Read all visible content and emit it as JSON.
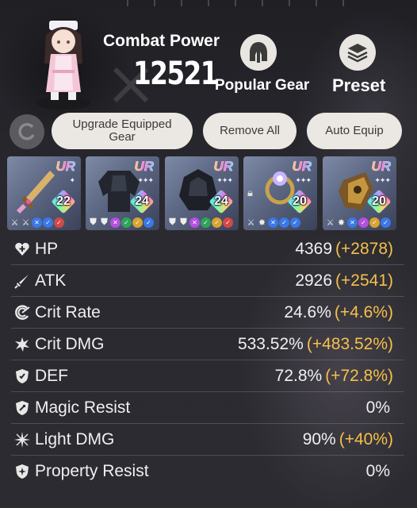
{
  "header": {
    "combat_power_label": "Combat Power",
    "combat_power_value": "12521",
    "popular_gear_label": "Popular Gear",
    "preset_label": "Preset"
  },
  "actions": {
    "upgrade_label": "Upgrade Equipped Gear",
    "remove_all_label": "Remove All",
    "auto_equip_label": "Auto Equip"
  },
  "gear": [
    {
      "rarity": "UR",
      "level": "22",
      "icon": "sword-icon",
      "locked": false
    },
    {
      "rarity": "UR",
      "level": "24",
      "icon": "armor-icon",
      "locked": false
    },
    {
      "rarity": "UR",
      "level": "24",
      "icon": "armor-icon",
      "locked": false
    },
    {
      "rarity": "UR",
      "level": "20",
      "icon": "ring-icon",
      "locked": true
    },
    {
      "rarity": "UR",
      "level": "20",
      "icon": "gauntlet-icon",
      "locked": false
    }
  ],
  "stats": [
    {
      "name": "HP",
      "value": "4369",
      "bonus": "(+2878)",
      "icon": "heart-plus-icon"
    },
    {
      "name": "ATK",
      "value": "2926",
      "bonus": "(+2541)",
      "icon": "sword-icon"
    },
    {
      "name": "Crit Rate",
      "value": "24.6%",
      "bonus": "(+4.6%)",
      "icon": "crit-rate-icon"
    },
    {
      "name": "Crit DMG",
      "value": "533.52%",
      "bonus": "(+483.52%)",
      "icon": "crit-dmg-icon"
    },
    {
      "name": "DEF",
      "value": "72.8%",
      "bonus": "(+72.8%)",
      "icon": "shield-icon"
    },
    {
      "name": "Magic Resist",
      "value": "0%",
      "bonus": "",
      "icon": "magic-shield-icon"
    },
    {
      "name": "Light DMG",
      "value": "90%",
      "bonus": "(+40%)",
      "icon": "light-burst-icon"
    },
    {
      "name": "Property Resist",
      "value": "0%",
      "bonus": "",
      "icon": "property-shield-icon"
    }
  ],
  "colors": {
    "bonus": "#f6c04a",
    "pill_bg": "#ebe7e2",
    "background": "#26262b"
  }
}
